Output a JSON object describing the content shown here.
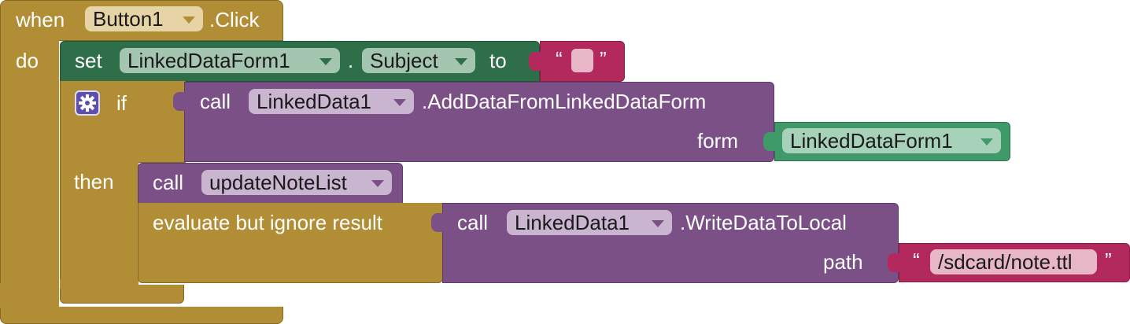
{
  "event_block": {
    "when_label": "when",
    "component": "Button1",
    "event": ".Click",
    "do_label": "do",
    "color": "#b18e35"
  },
  "set_block": {
    "set_label": "set",
    "component": "LinkedDataForm1",
    "dot": ".",
    "property": "Subject",
    "to_label": "to",
    "color": "#2e6e48"
  },
  "empty_text_block": {
    "open_quote": "“",
    "close_quote": "”",
    "color": "#b3295d"
  },
  "if_block": {
    "if_label": "if",
    "then_label": "then",
    "gear_icon": "gear-icon",
    "color": "#b18e35"
  },
  "add_data_call": {
    "call_label": "call",
    "component": "LinkedData1",
    "method": ".AddDataFromLinkedDataForm",
    "param_label": "form",
    "color": "#7a5087"
  },
  "form_component_block": {
    "component": "LinkedDataForm1",
    "color": "#3f9a6a"
  },
  "procedure_call": {
    "call_label": "call",
    "procedure": "updateNoteList",
    "color": "#7a5087"
  },
  "evaluate_block": {
    "label": "evaluate but ignore result",
    "color": "#b18e35"
  },
  "write_call": {
    "call_label": "call",
    "component": "LinkedData1",
    "method": ".WriteDataToLocal",
    "param_label": "path",
    "color": "#7a5087"
  },
  "path_text_block": {
    "open_quote": "“",
    "value": "/sdcard/note.ttl",
    "close_quote": "”",
    "color": "#b3295d"
  }
}
